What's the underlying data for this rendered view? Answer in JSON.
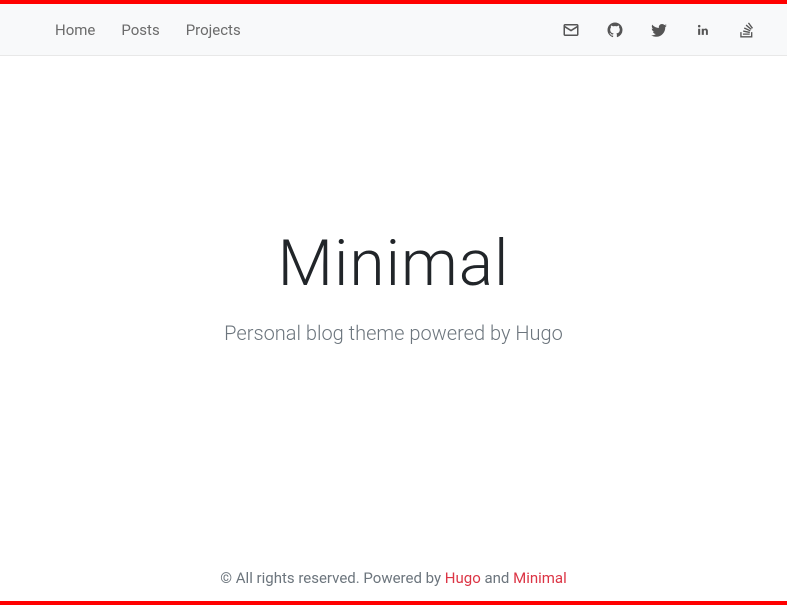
{
  "nav": {
    "links": [
      {
        "label": "Home"
      },
      {
        "label": "Posts"
      },
      {
        "label": "Projects"
      }
    ],
    "icons": [
      {
        "name": "email-icon"
      },
      {
        "name": "github-icon"
      },
      {
        "name": "twitter-icon"
      },
      {
        "name": "linkedin-icon"
      },
      {
        "name": "stackoverflow-icon"
      }
    ]
  },
  "hero": {
    "title": "Minimal",
    "subtitle": "Personal blog theme powered by Hugo"
  },
  "footer": {
    "prefix": "© All rights reserved. Powered by ",
    "link1_label": "Hugo",
    "separator": " and ",
    "link2_label": "Minimal"
  },
  "colors": {
    "accent": "#ff0000",
    "link": "#dc3545",
    "text_muted": "#6c757d",
    "icon": "#555555"
  }
}
